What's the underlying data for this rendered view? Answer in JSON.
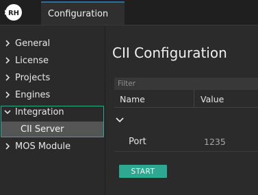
{
  "app": {
    "logo_text": "RH",
    "tab_label": "Configuration"
  },
  "sidebar": {
    "items": [
      {
        "label": "General",
        "expanded": false
      },
      {
        "label": "License",
        "expanded": false
      },
      {
        "label": "Projects",
        "expanded": false
      },
      {
        "label": "Engines",
        "expanded": false
      },
      {
        "label": "Integration",
        "expanded": true,
        "children": [
          {
            "label": "CII Server",
            "selected": true
          }
        ]
      },
      {
        "label": "MOS Module",
        "expanded": false
      }
    ]
  },
  "main": {
    "title": "CII Configuration",
    "filter_placeholder": "Filter",
    "columns": [
      "Name",
      "Value"
    ],
    "rows": [
      {
        "name": "Port",
        "value": "1235"
      }
    ],
    "start_label": "START"
  },
  "colors": {
    "accent": "#2ea890",
    "background": "#2b2b2b",
    "topbar": "#1f1f1f",
    "selected_bg": "#555555"
  }
}
